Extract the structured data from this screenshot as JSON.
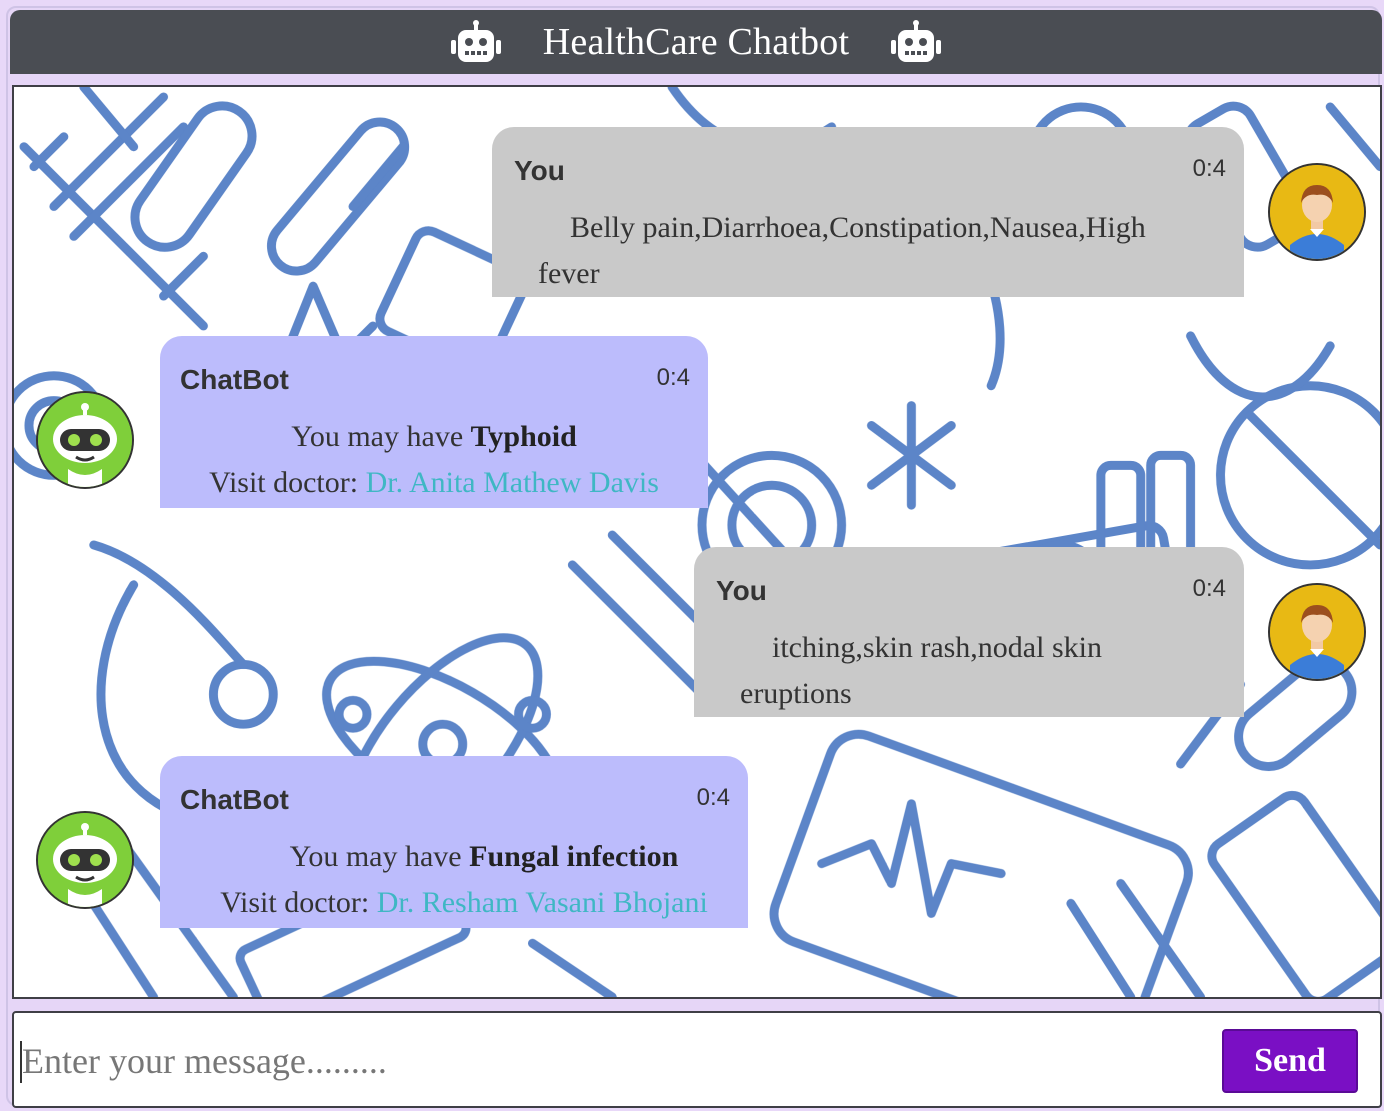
{
  "header": {
    "title": "HealthCare Chatbot",
    "left_icon": "robot-icon",
    "right_icon": "robot-icon",
    "background": "#4a4d53"
  },
  "messages": [
    {
      "sender": "You",
      "time": "0:4",
      "text_line1": "Belly pain,Diarrhoea,Constipation,Nausea,High",
      "text_line2": "fever",
      "avatar": "user-avatar-icon",
      "bubble_color": "#c9c9c9"
    },
    {
      "sender": "ChatBot",
      "time": "0:4",
      "prefix": "You may have ",
      "disease": "Typhoid",
      "doctor_prefix": "Visit doctor: ",
      "doctor": "Dr. Anita Mathew Davis",
      "avatar": "robot-avatar-icon",
      "bubble_color": "#bcbcfc"
    },
    {
      "sender": "You",
      "time": "0:4",
      "text_line1": "itching,skin rash,nodal skin",
      "text_line2": "eruptions",
      "avatar": "user-avatar-icon",
      "bubble_color": "#c9c9c9"
    },
    {
      "sender": "ChatBot",
      "time": "0:4",
      "prefix": "You may have ",
      "disease": "Fungal infection",
      "doctor_prefix": "Visit doctor: ",
      "doctor": "Dr. Resham Vasani Bhojani",
      "avatar": "robot-avatar-icon",
      "bubble_color": "#bcbcfc"
    }
  ],
  "input": {
    "placeholder": "Enter your message.........",
    "value": ""
  },
  "send_button": {
    "label": "Send",
    "color": "#7a0fc4"
  },
  "colors": {
    "page_background": "#e8d8f8",
    "doctor_link": "#3fb7c4",
    "pattern_stroke": "#4a78c2"
  }
}
